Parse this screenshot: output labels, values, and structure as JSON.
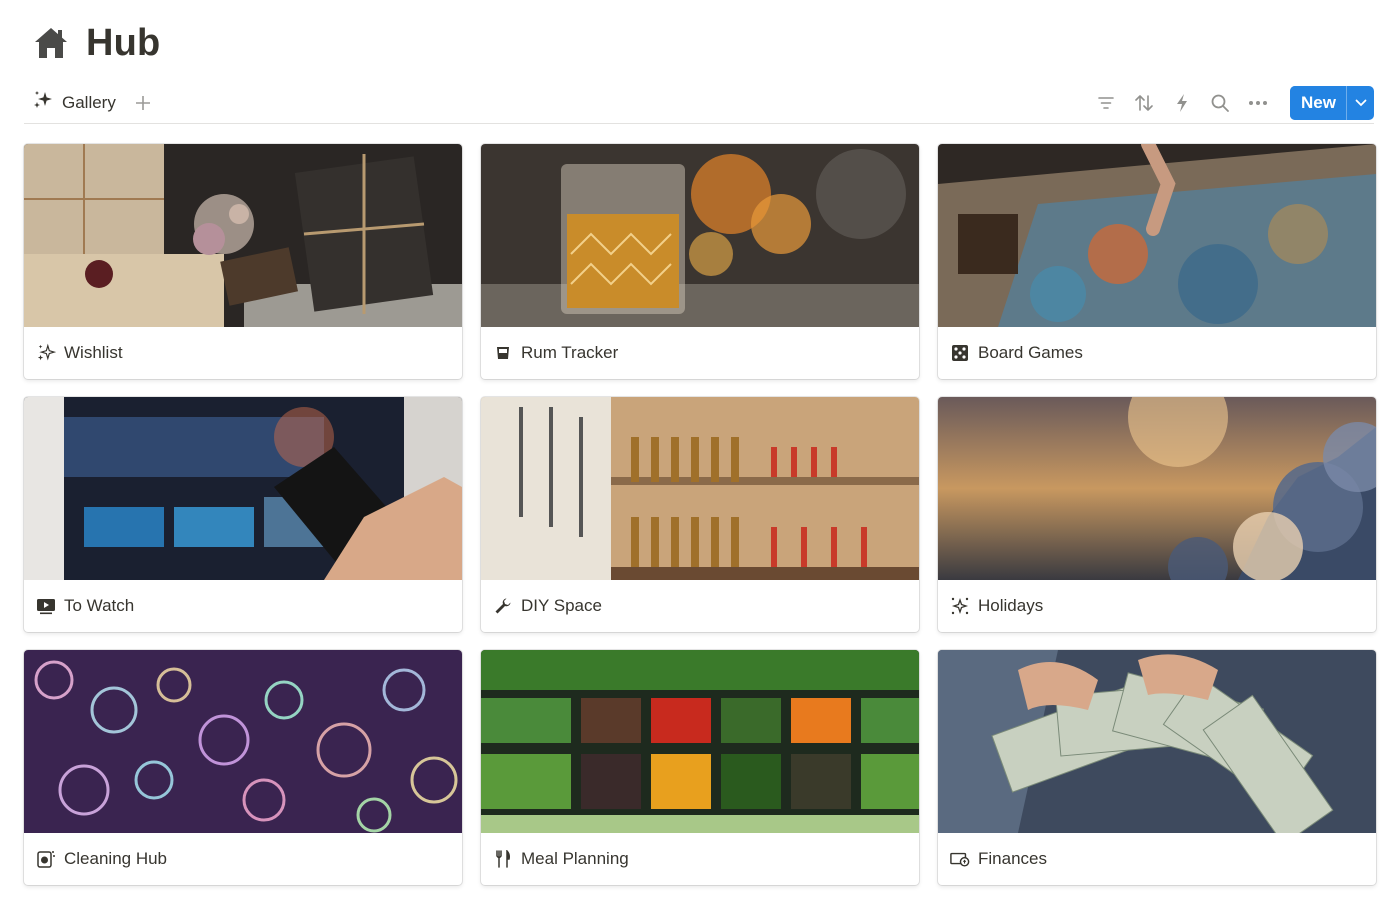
{
  "page": {
    "title": "Hub",
    "icon": "home-icon"
  },
  "views": {
    "active_tab": {
      "label": "Gallery",
      "icon": "sparkles-icon"
    },
    "add_icon": "plus-icon"
  },
  "toolbar": {
    "icons": [
      "filter-icon",
      "sort-icon",
      "automation-bolt-icon",
      "search-icon",
      "more-icon"
    ],
    "new_label": "New",
    "new_dropdown_icon": "chevron-down-icon",
    "accent_color": "#2383e2"
  },
  "cards": [
    {
      "title": "Wishlist",
      "icon": "sparkles-icon",
      "cover": "wrapped gifts"
    },
    {
      "title": "Rum Tracker",
      "icon": "glass-icon",
      "cover": "glass of rum by fire"
    },
    {
      "title": "Board Games",
      "icon": "dice-icon",
      "cover": "jigsaw puzzle"
    },
    {
      "title": "To Watch",
      "icon": "play-screen-icon",
      "cover": "tv remote"
    },
    {
      "title": "DIY Space",
      "icon": "wrench-icon",
      "cover": "tool wall"
    },
    {
      "title": "Holidays",
      "icon": "sparkle-burst-icon",
      "cover": "sunset clouds"
    },
    {
      "title": "Cleaning Hub",
      "icon": "washing-machine-icon",
      "cover": "soap bubbles"
    },
    {
      "title": "Meal Planning",
      "icon": "fork-knife-icon",
      "cover": "vegetable market"
    },
    {
      "title": "Finances",
      "icon": "money-icon",
      "cover": "dollar bills"
    }
  ]
}
